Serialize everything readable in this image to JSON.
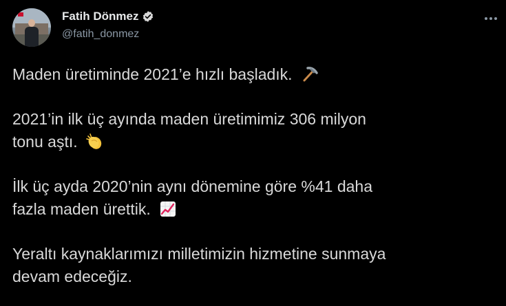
{
  "author": {
    "display_name": "Fatih Dönmez",
    "handle": "@fatih_donmez",
    "verified": true
  },
  "tweet": {
    "paragraphs": [
      {
        "lines": [
          "Maden üretiminde 2021’e hızlı başladık."
        ],
        "emoji": "pick-icon"
      },
      {
        "lines": [
          "2021’in ilk üç ayında maden üretimimiz 306 milyon",
          "tonu aştı."
        ],
        "emoji": "clapping-hands-icon"
      },
      {
        "lines": [
          "İlk üç ayda 2020’nin aynı dönemine göre %41 daha",
          "fazla maden ürettik."
        ],
        "emoji": "chart-increasing-icon"
      },
      {
        "lines": [
          "Yeraltı kaynaklarımızı milletimizin hizmetine sunmaya",
          "devam edeceğiz."
        ],
        "emoji": null
      }
    ]
  },
  "colors": {
    "background": "#000000",
    "name": "#e7e9ea",
    "text": "#d9d9d9",
    "muted": "#8b98a5",
    "verified_badge": "#d9d9d9"
  }
}
